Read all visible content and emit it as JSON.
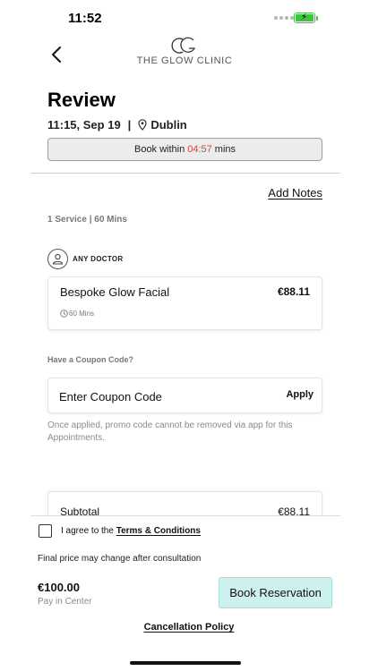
{
  "status_bar": {
    "time": "11:52",
    "battery_color": "#3ec33e"
  },
  "header": {
    "back_icon": "chevron-left-icon",
    "logo_icon": "glow-clinic-monogram-icon",
    "logo_text": "THE GLOW CLINIC"
  },
  "review": {
    "title": "Review",
    "datetime": "11:15, Sep 19",
    "separator": "|",
    "location_icon": "map-pin-icon",
    "location": "Dublin",
    "timer": {
      "prefix": "Book within",
      "countdown": "04:57",
      "suffix": "mins",
      "countdown_color": "#e0423c"
    },
    "add_notes_label": "Add Notes",
    "service_summary": "1 Service | 60 Mins"
  },
  "doctor": {
    "icon": "user-icon",
    "label": "ANY DOCTOR"
  },
  "service": {
    "name": "Bespoke Glow Facial",
    "price": "€88.11",
    "duration_icon": "clock-icon",
    "duration": "60 Mins"
  },
  "coupon": {
    "heading": "Have a Coupon Code?",
    "placeholder": "Enter Coupon Code",
    "apply_label": "Apply",
    "note": "Once applied, promo code cannot be removed via app for this Appointments."
  },
  "summary": {
    "subtotal_label": "Subtotal",
    "subtotal_value": "€88.11"
  },
  "footer": {
    "agree_prefix": "I agree to the",
    "terms_label": "Terms & Conditions",
    "price_note": "Final price may change after consultation",
    "total_price": "€100.00",
    "pay_label": "Pay in Center",
    "book_label": "Book Reservation",
    "book_button_color": "#cdf1ef",
    "cancellation_label": "Cancellation Policy"
  }
}
